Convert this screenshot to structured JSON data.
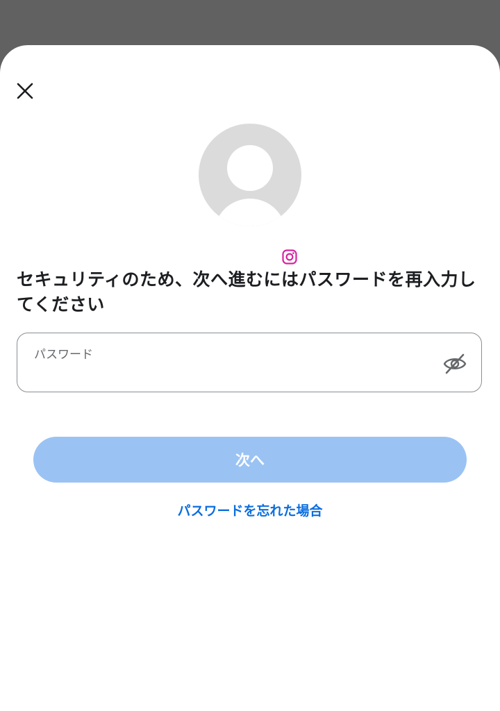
{
  "colors": {
    "backdrop": "#616161",
    "sheet": "#ffffff",
    "primary_button_disabled": "#9ac3f4",
    "link": "#0b6ee0",
    "text_primary": "#1c1e21",
    "text_secondary": "#65676b",
    "instagram_badge": "#d6249f"
  },
  "icons": {
    "close": "close-icon",
    "avatar": "default-avatar-icon",
    "badge": "instagram-icon",
    "password_visibility": "eye-off-icon"
  },
  "reauth": {
    "prompt": "セキュリティのため、次へ進むにはパスワードを再入力してください",
    "password_field": {
      "label": "パスワード",
      "value": ""
    },
    "next_button_label": "次へ",
    "forgot_password_label": "パスワードを忘れた場合"
  }
}
